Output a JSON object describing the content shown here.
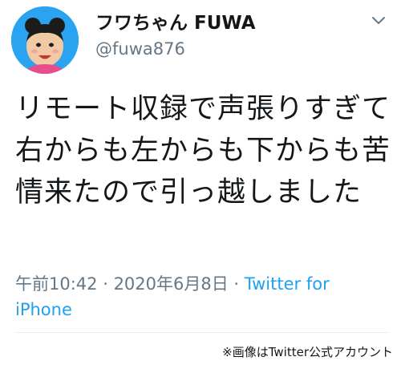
{
  "user": {
    "display_name": "フワちゃん FUWA",
    "handle": "@fuwa876",
    "avatar_icon": "profile-photo-avatar"
  },
  "tweet": {
    "text": "リモート収録で声張りすぎて右からも左からも下からも苦情来たので引っ越しました",
    "time": "午前10:42",
    "separator": " · ",
    "date": "2020年6月8日",
    "source": "Twitter for iPhone"
  },
  "menu": {
    "icon": "chevron-down-icon"
  },
  "credit": "※画像はTwitter公式アカウント",
  "colors": {
    "text": "#14171a",
    "secondary": "#657786",
    "link": "#1da1f2",
    "avatar_bg": "#2aa3f0"
  }
}
